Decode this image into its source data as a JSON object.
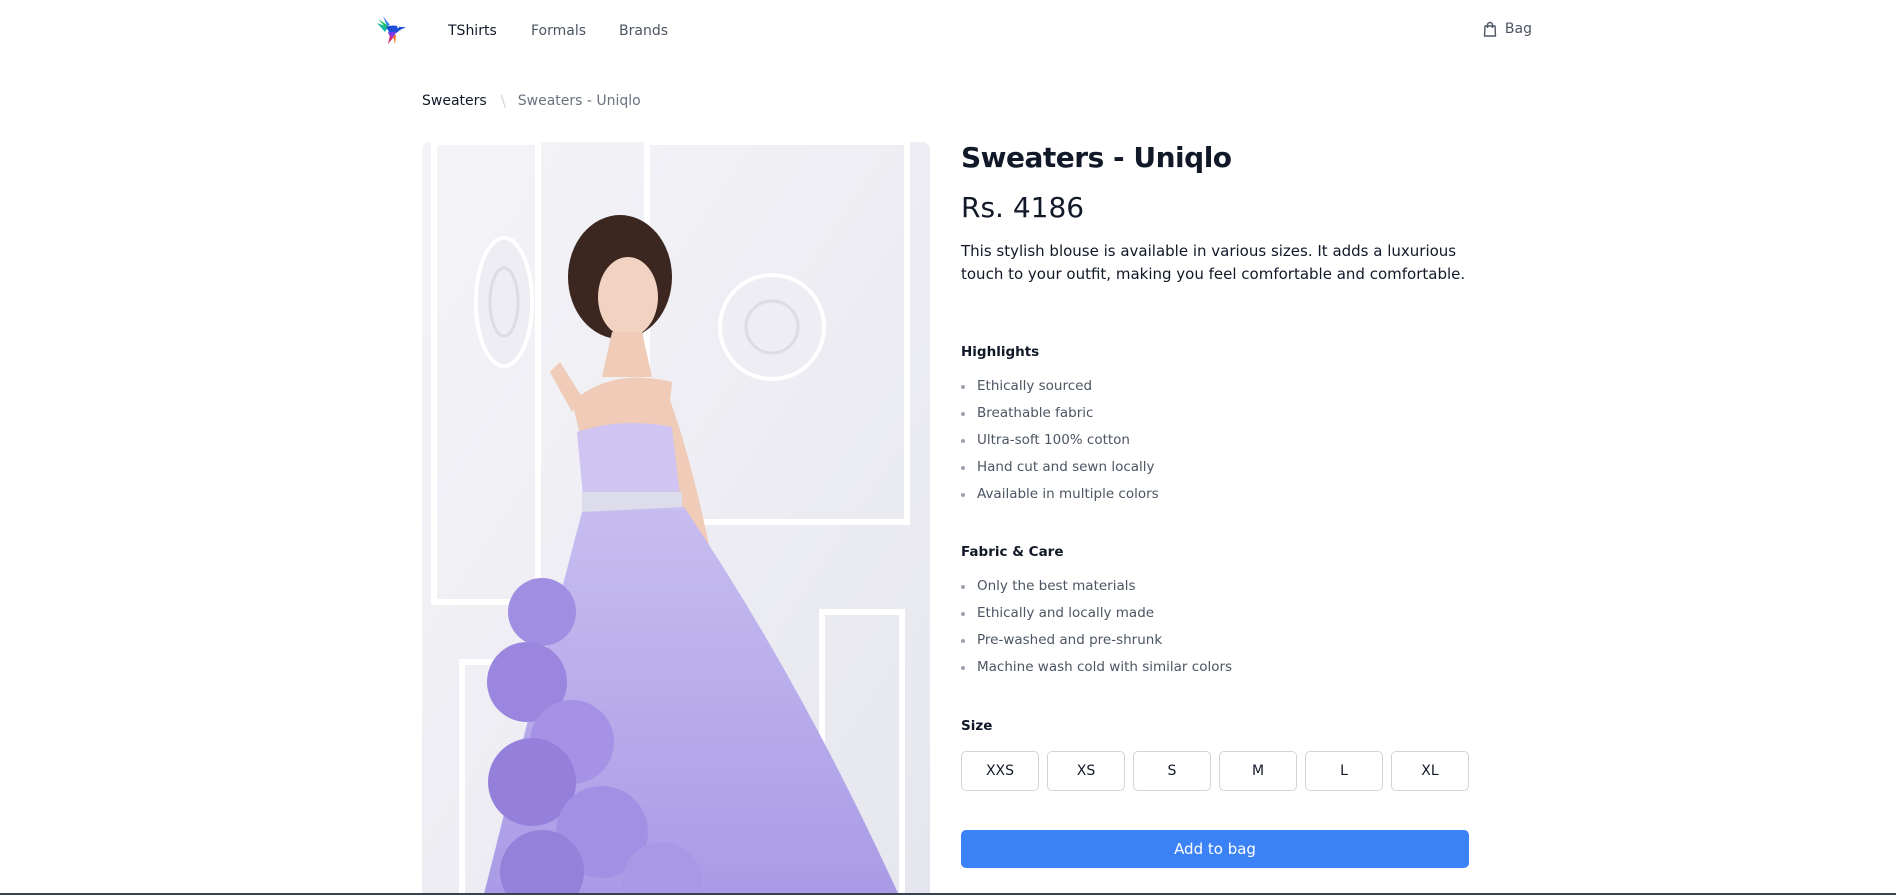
{
  "nav": {
    "links": [
      {
        "label": "TShirts"
      },
      {
        "label": "Formals"
      },
      {
        "label": "Brands"
      }
    ],
    "bag_label": "Bag"
  },
  "breadcrumb": {
    "parent": "Sweaters",
    "current": "Sweaters - Uniqlo"
  },
  "product": {
    "title": "Sweaters - Uniqlo",
    "price": "Rs. 4186",
    "description": "This stylish blouse is available in various sizes. It adds a luxurious touch to your outfit, making you feel comfortable and comfortable."
  },
  "highlights": {
    "heading": "Highlights",
    "items": [
      "Ethically sourced",
      "Breathable fabric",
      "Ultra-soft 100% cotton",
      "Hand cut and sewn locally",
      "Available in multiple colors"
    ]
  },
  "care": {
    "heading": "Fabric & Care",
    "items": [
      "Only the best materials",
      "Ethically and locally made",
      "Pre-washed and pre-shrunk",
      "Machine wash cold with similar colors"
    ]
  },
  "size": {
    "heading": "Size",
    "options": [
      "XXS",
      "XS",
      "S",
      "M",
      "L",
      "XL"
    ]
  },
  "cta": {
    "add_to_bag": "Add to bag"
  },
  "colors": {
    "accent": "#3b82f6",
    "text": "#111827",
    "muted": "#4b5563",
    "border": "#d1d5db"
  }
}
